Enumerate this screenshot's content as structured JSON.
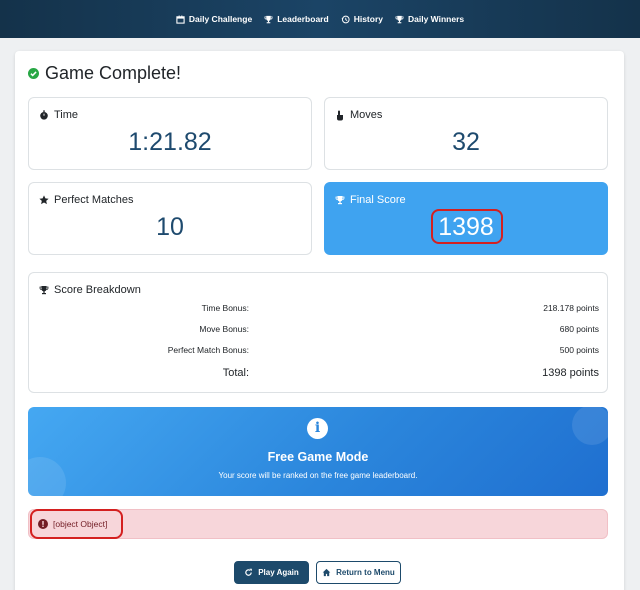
{
  "nav": {
    "items": [
      {
        "label": "Daily Challenge",
        "icon": "calendar-icon"
      },
      {
        "label": "Leaderboard",
        "icon": "trophy-icon"
      },
      {
        "label": "History",
        "icon": "history-icon"
      },
      {
        "label": "Daily Winners",
        "icon": "trophy-icon"
      }
    ]
  },
  "title": "Game Complete!",
  "stats": {
    "time": {
      "label": "Time",
      "value": "1:21.82"
    },
    "moves": {
      "label": "Moves",
      "value": "32"
    },
    "perfect_matches": {
      "label": "Perfect Matches",
      "value": "10"
    },
    "final_score": {
      "label": "Final Score",
      "value": "1398"
    }
  },
  "breakdown": {
    "title": "Score Breakdown",
    "rows": [
      {
        "label": "Time Bonus:",
        "value": "218.178 points"
      },
      {
        "label": "Move Bonus:",
        "value": "680 points"
      },
      {
        "label": "Perfect Match Bonus:",
        "value": "500 points"
      }
    ],
    "total": {
      "label": "Total:",
      "value": "1398 points"
    }
  },
  "mode": {
    "icon": "i",
    "title": "Free Game Mode",
    "subtitle": "Your score will be ranked on the free game leaderboard."
  },
  "alert": {
    "text": "[object Object]"
  },
  "buttons": {
    "play_again": "Play Again",
    "return_menu": "Return to Menu"
  },
  "colors": {
    "accent": "#1d4a6b",
    "final_score_bg": "#3fa3f0",
    "success": "#28a745",
    "alert_bg": "#f7d6da",
    "highlight": "#d42020"
  }
}
